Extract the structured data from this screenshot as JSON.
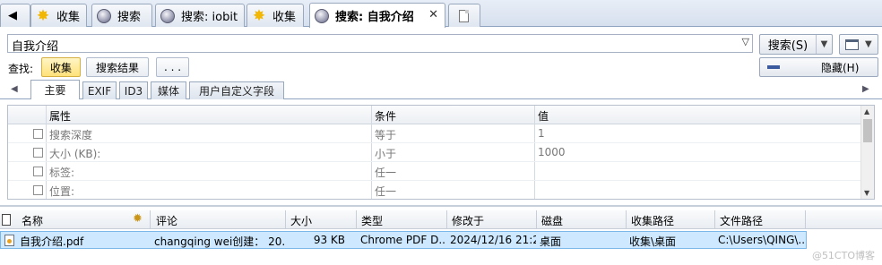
{
  "tabs": [
    {
      "label": "收集",
      "icon": "star-icon"
    },
    {
      "label": "搜索",
      "icon": "globe-icon"
    },
    {
      "label": "搜索: iobit",
      "icon": "globe-icon"
    },
    {
      "label": "收集",
      "icon": "star-icon"
    },
    {
      "label": "搜索: 自我介绍",
      "icon": "globe-icon",
      "active": true
    }
  ],
  "search": {
    "query": "自我介绍",
    "button_label": "搜索(S)"
  },
  "find": {
    "label": "查找:",
    "buttons": [
      "收集",
      "搜索结果",
      ". . ."
    ]
  },
  "hide_button": "隐藏(H)",
  "subtabs": [
    "主要",
    "EXIF",
    "ID3",
    "媒体",
    "用户自定义字段"
  ],
  "grid": {
    "headers": [
      "属性",
      "条件",
      "值"
    ],
    "rows": [
      {
        "property": "搜索深度",
        "condition": "等于",
        "value": "1"
      },
      {
        "property": "大小 (KB):",
        "condition": "小于",
        "value": "1000"
      },
      {
        "property": "标签:",
        "condition": "任一",
        "value": ""
      },
      {
        "property": "位置:",
        "condition": "任一",
        "value": ""
      }
    ]
  },
  "list": {
    "headers": [
      "名称",
      "评论",
      "大小",
      "类型",
      "修改于",
      "磁盘",
      "收集路径",
      "文件路径"
    ],
    "rows": [
      {
        "name": "自我介绍.pdf",
        "comment": "changqing wei创建： 20...",
        "size": "93 KB",
        "type": "Chrome PDF D...",
        "modified": "2024/12/16 21:2...",
        "disk": "桌面",
        "collection_path": "收集\\桌面",
        "file_path": "C:\\Users\\QING\\..."
      }
    ]
  },
  "watermark": "@51CTO博客",
  "colors": {
    "selection": "#cde8ff",
    "find_selected": "#ffe27a",
    "tab_bg": "#d6e0ee"
  }
}
